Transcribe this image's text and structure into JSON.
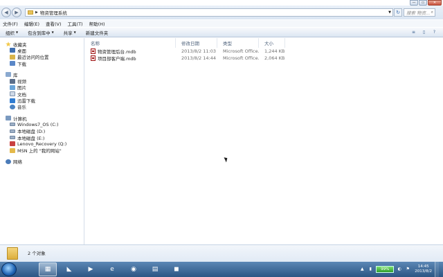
{
  "window": {
    "caption_buttons": [
      "—",
      "▭",
      "✕"
    ]
  },
  "address_bar": {
    "path": "物资管理系统",
    "back_glyph": "◀",
    "forward_glyph": "▶",
    "path_arrow": "▶",
    "dropdown_glyph": "▼",
    "refresh_glyph": "↻",
    "search_placeholder": "搜索 物资...",
    "search_glyph": "⌕"
  },
  "menu": [
    "文件(F)",
    "编辑(E)",
    "查看(V)",
    "工具(T)",
    "帮助(H)"
  ],
  "commands": {
    "organize": "组织",
    "include_in_library": "包含到库中",
    "share": "共享",
    "new_folder": "新建文件夹",
    "right_icons": [
      "≡",
      "▯",
      "?"
    ]
  },
  "nav": {
    "favorites": {
      "label": "收藏夹",
      "items": [
        "桌面",
        "最近访问的位置",
        "下载"
      ]
    },
    "libraries": {
      "label": "库",
      "items": [
        "视频",
        "图片",
        "文档",
        "迅雷下载",
        "音乐"
      ]
    },
    "computer": {
      "label": "计算机",
      "items": [
        "Windows7_OS (C:)",
        "本地磁盘 (D:)",
        "本地磁盘 (E:)",
        "Lenovo_Recovery (Q:)",
        "MSN 上的 \"我的网站\""
      ]
    },
    "network": {
      "label": "网络"
    }
  },
  "columns": {
    "name": "名称",
    "date": "修改日期",
    "type": "类型",
    "size": "大小"
  },
  "files": [
    {
      "name": "物资管理后台.mdb",
      "date": "2013/8/2 11:03",
      "type": "Microsoft Office...",
      "size": "1,244 KB"
    },
    {
      "name": "项目部客户端.mdb",
      "date": "2013/8/2 14:44",
      "type": "Microsoft Office...",
      "size": "2,064 KB"
    }
  ],
  "details": {
    "count": "2 个对象"
  },
  "taskbar": {
    "battery": "99%",
    "time": "14:45",
    "date": "2013/8/2"
  },
  "colors": {
    "taskbar": "#2d5684",
    "accent": "#3a6fb2"
  }
}
